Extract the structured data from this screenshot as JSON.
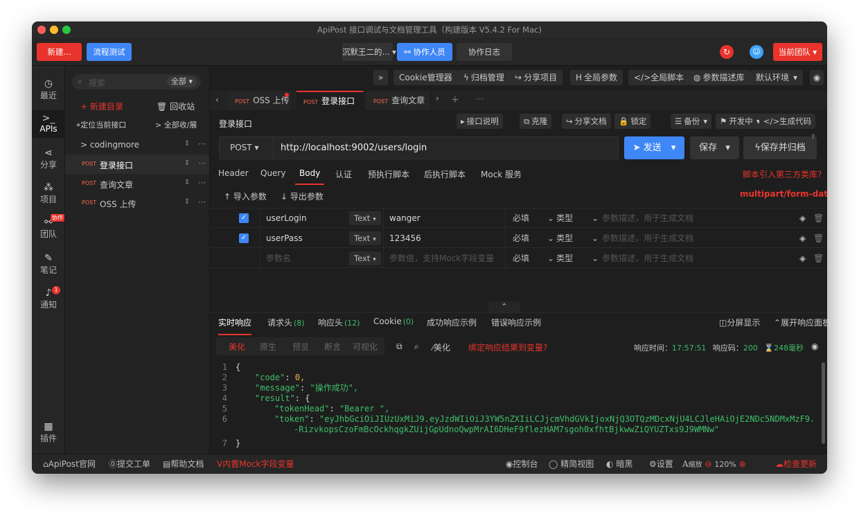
{
  "window": {
    "title": "ApiPost 接口调试与文档管理工具（构建版本 V5.4.2 For Mac)"
  },
  "topbar": {
    "new": "新建...",
    "flow": "流程测试",
    "user": "沉默王二的...",
    "collab": "协作人员",
    "log": "协作日志",
    "team": "当前团队"
  },
  "nav": {
    "recent": "最近",
    "apis": "APIs",
    "share": "分享",
    "project": "项目",
    "team": "团队",
    "team_badge": "协作",
    "notes": "笔记",
    "notify": "通知",
    "notify_count": "1",
    "plugins": "插件"
  },
  "sidebar": {
    "search_placeholder": "搜索",
    "filter": "全部",
    "new_dir": "+ 新建目录",
    "trash": "回收站",
    "locate": "定位当前接口",
    "collapse": "> 全部收/展",
    "items": [
      {
        "method": "",
        "label": "> codingmore"
      },
      {
        "method": "POST",
        "label": "登录接口"
      },
      {
        "method": "POST",
        "label": "查询文章"
      },
      {
        "method": "POST",
        "label": "OSS 上传"
      }
    ]
  },
  "toolbar": [
    "»",
    "Cookie管理器",
    "归档管理",
    "分享项目",
    "全局参数",
    "</>全局脚本",
    "参数描述库",
    "默认环境"
  ],
  "tabs": [
    {
      "method": "POST",
      "label": "OSS 上传"
    },
    {
      "method": "POST",
      "label": "登录接口"
    },
    {
      "method": "POST",
      "label": "查询文章"
    }
  ],
  "request": {
    "name": "登录接口",
    "actions": [
      "接口说明",
      "克隆",
      "分享文档",
      "锁定",
      "备份",
      "开发中",
      "</>生成代码"
    ],
    "method": "POST",
    "url": "http://localhost:9002/users/login",
    "send": "发送",
    "save": "保存",
    "save_archive": "保存并归档"
  },
  "subtabs": {
    "items": [
      "Header",
      "Query",
      "Body",
      "认证",
      "预执行脚本",
      "后执行脚本",
      "Mock 服务"
    ],
    "right": "脚本引入第三方类库?"
  },
  "body": {
    "import": "导入参数",
    "export": "导出参数",
    "content_type": "multipart/form-data",
    "required": "必填",
    "type": "类型",
    "desc_placeholder": "参数描述，用于生成文档",
    "rows": [
      {
        "checked": true,
        "name": "userLogin",
        "ptype": "Text",
        "value": "wanger"
      },
      {
        "checked": true,
        "name": "userPass",
        "ptype": "Text",
        "value": "123456"
      },
      {
        "checked": false,
        "name": "",
        "ptype": "Text",
        "value": ""
      }
    ],
    "name_placeholder": "参数名",
    "value_placeholder": "参数值，支持Mock字段变量"
  },
  "response": {
    "tabs": [
      {
        "label": "实时响应",
        "count": ""
      },
      {
        "label": "请求头",
        "count": "(8)"
      },
      {
        "label": "响应头",
        "count": "(12)"
      },
      {
        "label": "Cookie",
        "count": "(0)"
      },
      {
        "label": "成功响应示例",
        "count": ""
      },
      {
        "label": "错误响应示例",
        "count": ""
      }
    ],
    "split": "分屏显示",
    "expand": "展开响应面板",
    "views": [
      "美化",
      "原生",
      "预览",
      "断言",
      "可视化"
    ],
    "beautify": "美化",
    "bind_var": "绑定响应结果到变量?",
    "time_label": "响应时间：",
    "time": "17:57:51",
    "code_label": "响应码：",
    "code": "200",
    "duration": "248毫秒",
    "lines": [
      {
        "n": "1",
        "t": "{"
      },
      {
        "n": "2",
        "k": "\"code\"",
        "v": "0,"
      },
      {
        "n": "3",
        "k": "\"message\"",
        "s": "\"操作成功\","
      },
      {
        "n": "4",
        "k": "\"result\"",
        "v": "{"
      },
      {
        "n": "5",
        "k": "\"tokenHead\"",
        "s": "\"Bearer \","
      },
      {
        "n": "6",
        "k": "\"token\"",
        "s": "\"eyJhbGciOiJIUzUxMiJ9.eyJzdWIiOiJ3YW5nZXIiLCJjcmVhdGVkIjoxNjQ3OTQzMDcxNjU4LCJleHAiOjE2NDc5NDMxMzF9.DP"
      },
      {
        "n": "",
        "s": "-RizvkopsCzoFmBcOckhqgkZUijGpUdnoQwpMrAI6DHeF9flezHAM7sgoh0xfhtBjkwwZiQYUZTxs9J9WMNw\""
      },
      {
        "n": "7",
        "t": "}"
      }
    ]
  },
  "status": {
    "site": "ApiPost官网",
    "ticket": "提交工单",
    "docs": "帮助文档",
    "mock": "内置Mock字段变量",
    "console": "控制台",
    "simple": "精简视图",
    "dark": "暗黑",
    "settings": "设置",
    "zoom_label": "缩放",
    "zoom": "120%",
    "update": "检查更新"
  },
  "colors": {
    "accent": "#e8342c",
    "blue": "#3f86f7",
    "green": "#3fbf6b"
  }
}
